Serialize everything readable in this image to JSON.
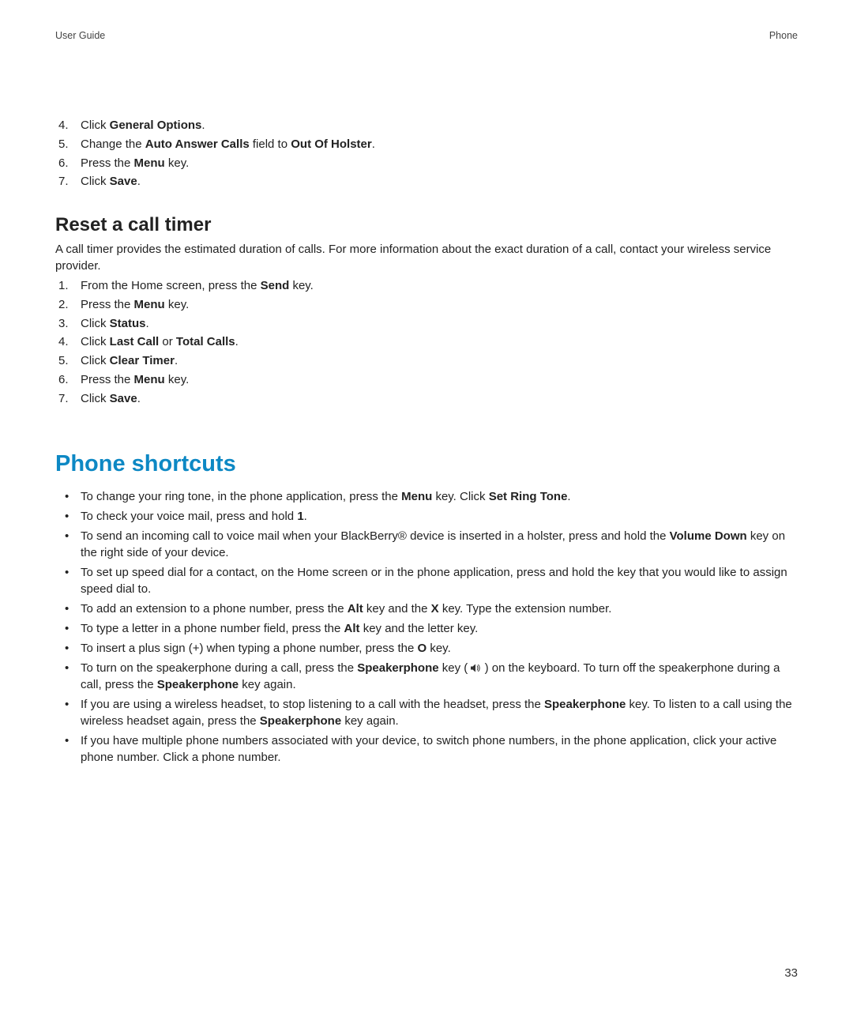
{
  "header": {
    "left": "User Guide",
    "right": "Phone"
  },
  "list_a": {
    "start": 4,
    "items": [
      {
        "segs": [
          {
            "t": "Click "
          },
          {
            "t": "General Options",
            "b": true
          },
          {
            "t": "."
          }
        ]
      },
      {
        "segs": [
          {
            "t": "Change the "
          },
          {
            "t": "Auto Answer Calls",
            "b": true
          },
          {
            "t": " field to "
          },
          {
            "t": "Out Of Holster",
            "b": true
          },
          {
            "t": "."
          }
        ]
      },
      {
        "segs": [
          {
            "t": "Press the "
          },
          {
            "t": "Menu",
            "b": true
          },
          {
            "t": " key."
          }
        ]
      },
      {
        "segs": [
          {
            "t": "Click "
          },
          {
            "t": "Save",
            "b": true
          },
          {
            "t": "."
          }
        ]
      }
    ]
  },
  "h3_a": "Reset a call timer",
  "para_a": "A call timer provides the estimated duration of calls. For more information about the exact duration of a call, contact your wireless service provider.",
  "list_b": {
    "start": 1,
    "items": [
      {
        "segs": [
          {
            "t": "From the Home screen, press the "
          },
          {
            "t": "Send",
            "b": true
          },
          {
            "t": " key."
          }
        ]
      },
      {
        "segs": [
          {
            "t": "Press the "
          },
          {
            "t": "Menu",
            "b": true
          },
          {
            "t": " key."
          }
        ]
      },
      {
        "segs": [
          {
            "t": "Click "
          },
          {
            "t": "Status",
            "b": true
          },
          {
            "t": "."
          }
        ]
      },
      {
        "segs": [
          {
            "t": "Click "
          },
          {
            "t": "Last Call",
            "b": true
          },
          {
            "t": " or "
          },
          {
            "t": "Total Calls",
            "b": true
          },
          {
            "t": "."
          }
        ]
      },
      {
        "segs": [
          {
            "t": "Click "
          },
          {
            "t": "Clear Timer",
            "b": true
          },
          {
            "t": "."
          }
        ]
      },
      {
        "segs": [
          {
            "t": "Press the "
          },
          {
            "t": "Menu",
            "b": true
          },
          {
            "t": " key."
          }
        ]
      },
      {
        "segs": [
          {
            "t": "Click "
          },
          {
            "t": "Save",
            "b": true
          },
          {
            "t": "."
          }
        ]
      }
    ]
  },
  "h2_a": "Phone shortcuts",
  "bullets": [
    {
      "segs": [
        {
          "t": "To change your ring tone, in the phone application, press the "
        },
        {
          "t": "Menu",
          "b": true
        },
        {
          "t": " key. Click "
        },
        {
          "t": "Set Ring Tone",
          "b": true
        },
        {
          "t": "."
        }
      ]
    },
    {
      "segs": [
        {
          "t": "To check your voice mail, press and hold "
        },
        {
          "t": "1",
          "b": true
        },
        {
          "t": "."
        }
      ]
    },
    {
      "segs": [
        {
          "t": "To send an incoming call to voice mail when your BlackBerry® device is inserted in a holster, press and hold the "
        },
        {
          "t": "Volume Down",
          "b": true
        },
        {
          "t": " key on the right side of your device."
        }
      ]
    },
    {
      "segs": [
        {
          "t": "To set up speed dial for a contact, on the Home screen or in the phone application, press and hold the key that you would like to assign speed dial to."
        }
      ]
    },
    {
      "segs": [
        {
          "t": "To add an extension to a phone number, press the "
        },
        {
          "t": "Alt",
          "b": true
        },
        {
          "t": " key and the "
        },
        {
          "t": "X",
          "b": true
        },
        {
          "t": " key. Type the extension number."
        }
      ]
    },
    {
      "segs": [
        {
          "t": "To type a letter in a phone number field, press the "
        },
        {
          "t": "Alt",
          "b": true
        },
        {
          "t": " key and the letter key."
        }
      ]
    },
    {
      "segs": [
        {
          "t": "To insert a plus sign (+) when typing a phone number, press the "
        },
        {
          "t": "O",
          "b": true
        },
        {
          "t": " key."
        }
      ]
    },
    {
      "segs": [
        {
          "t": "To turn on the speakerphone during a call, press the "
        },
        {
          "t": "Speakerphone",
          "b": true
        },
        {
          "t": " key ( "
        },
        {
          "icon": "speaker"
        },
        {
          "t": " ) on the keyboard. To turn off the speakerphone during a call, press the "
        },
        {
          "t": "Speakerphone",
          "b": true
        },
        {
          "t": " key again."
        }
      ]
    },
    {
      "segs": [
        {
          "t": "If you are using a wireless headset, to stop listening to a call with the headset, press the "
        },
        {
          "t": "Speakerphone",
          "b": true
        },
        {
          "t": " key. To listen to a call using the wireless headset again, press the "
        },
        {
          "t": "Speakerphone",
          "b": true
        },
        {
          "t": " key again."
        }
      ]
    },
    {
      "segs": [
        {
          "t": "If you have multiple phone numbers associated with your device, to switch phone numbers, in the phone application, click your active phone number. Click a phone number."
        }
      ]
    }
  ],
  "page_number": "33"
}
